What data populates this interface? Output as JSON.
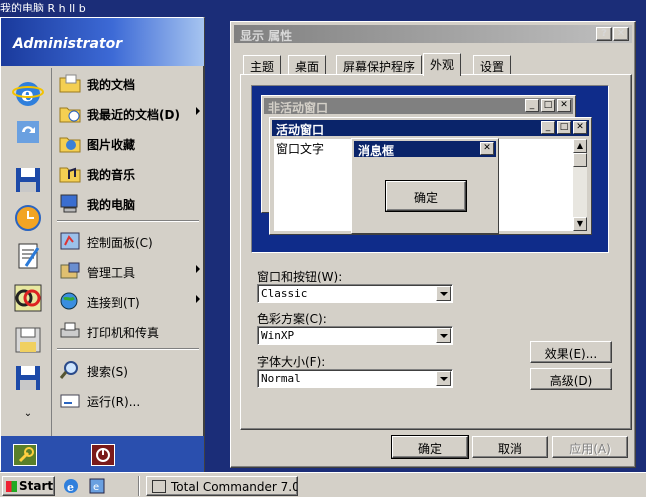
{
  "desktop": {
    "partial_label": "我的电脑    R  h   ll  b  "
  },
  "start_menu": {
    "user": "Administrator",
    "items": [
      {
        "label": "我的文档",
        "bold": true
      },
      {
        "label": "我最近的文档(D)",
        "bold": true
      },
      {
        "label": "图片收藏",
        "bold": true
      },
      {
        "label": "我的音乐",
        "bold": true
      },
      {
        "label": "我的电脑",
        "bold": true
      },
      {
        "label": "控制面板(C)",
        "bold": false
      },
      {
        "label": "管理工具",
        "bold": false
      },
      {
        "label": "连接到(T)",
        "bold": false
      },
      {
        "label": "打印机和传真",
        "bold": false
      },
      {
        "label": "搜索(S)",
        "bold": false
      },
      {
        "label": "运行(R)...",
        "bold": false
      }
    ]
  },
  "dialog": {
    "title": "显示 属性",
    "help_glyph": "?",
    "close_glyph": "✕",
    "tabs": [
      "主题",
      "桌面",
      "屏幕保护程序",
      "外观",
      "设置"
    ],
    "active_tab": "外观",
    "preview": {
      "inactive_title": "非活动窗口",
      "active_title": "活动窗口",
      "window_text": "窗口文字",
      "msgbox_title": "消息框",
      "ok_label": "确定"
    },
    "windows_buttons_label": "窗口和按钮(W):",
    "windows_buttons_value": "Classic",
    "color_scheme_label": "色彩方案(C):",
    "color_scheme_value": "WinXP",
    "font_size_label": "字体大小(F):",
    "font_size_value": "Normal",
    "effects_label": "效果(E)...",
    "advanced_label": "高级(D)",
    "ok_label": "确定",
    "cancel_label": "取消",
    "apply_label": "应用(A)"
  },
  "taskbar": {
    "start_label": "Start",
    "task_label": "Total Commander 7.0..."
  },
  "colors": {
    "desktop": "#1b2d78",
    "active_title": "#0a246a",
    "inactive_title": "#808080",
    "face": "#d4d0c8"
  }
}
